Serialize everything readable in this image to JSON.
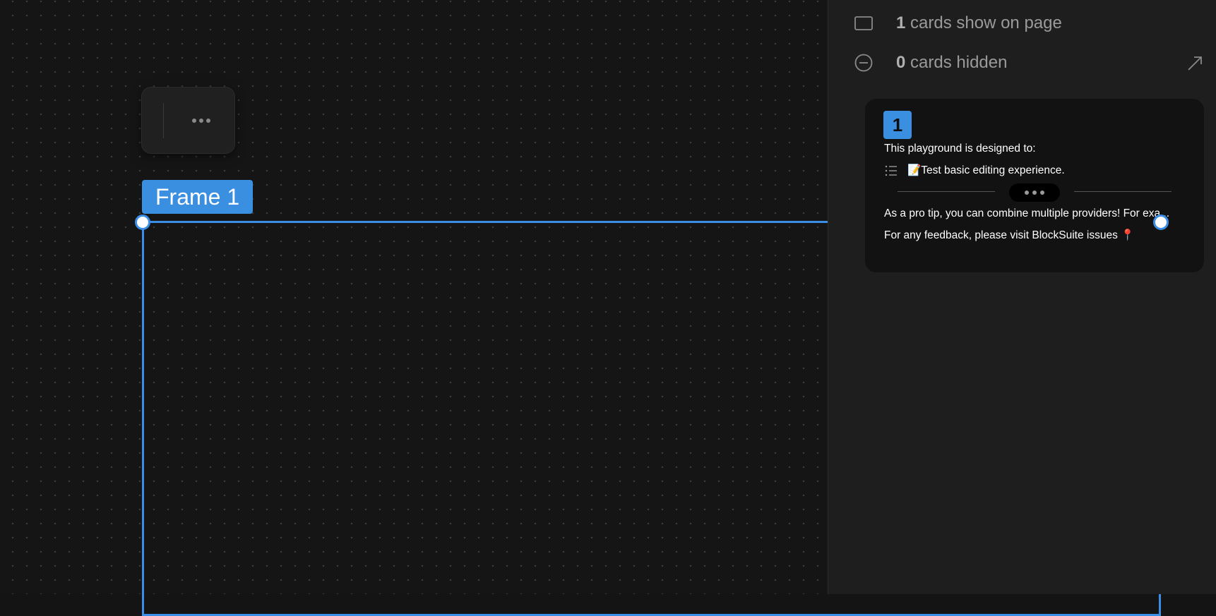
{
  "canvas": {
    "frame_label": "Frame 1"
  },
  "panel": {
    "shown": {
      "count": "1",
      "label": " cards show on page"
    },
    "hidden": {
      "count": "0",
      "label": " cards hidden"
    }
  },
  "card": {
    "number": "1",
    "line1": "This playground is designed to:",
    "list_item": "📝Test basic editing experience.",
    "line3": "As a pro tip, you can combine multiple providers! For exa...",
    "line4": "For any feedback, please visit BlockSuite issues 📍"
  },
  "colors": {
    "accent": "#3b8fe0",
    "canvas_bg": "#151515",
    "panel_bg": "#1e1e1e",
    "card_bg": "#121212"
  },
  "icons": [
    "more-icon",
    "frame-handle-icon",
    "card-show-icon",
    "card-hidden-icon",
    "expand-icon",
    "list-icon"
  ]
}
